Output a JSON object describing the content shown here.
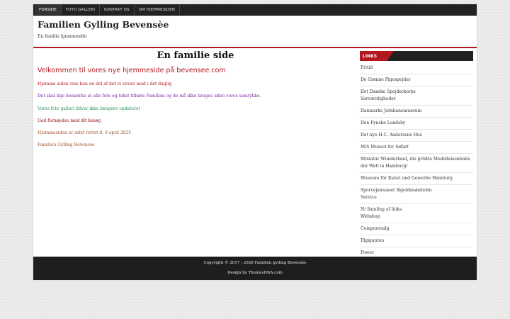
{
  "nav": {
    "items": [
      {
        "label": "Forside"
      },
      {
        "label": "Foto galleri"
      },
      {
        "label": "Kontakt os"
      },
      {
        "label": "Om hjemmesiden"
      }
    ]
  },
  "header": {
    "title": "Familien Gylling Bevensèe",
    "description": "En familie hjemmeside"
  },
  "main": {
    "page_title": "En familie side",
    "welcome": "Velkommen til vores nye hjemmeside på bevensee.com",
    "paragraphs": [
      {
        "text": "Hjemme siden vise kun en del af det vi sysler med i det daglig",
        "color": "#b3181f"
      },
      {
        "text": "Det skal lige bemærke at alle foto og tekst tilhøre Familien og de må ikke bruges uden vores samtykke.",
        "color": "#7b1fa2"
      },
      {
        "text": "Vores foto galleri bliver ikke længere opdateret",
        "color": "#2e8b57"
      },
      {
        "text": "God fornøjelse med dit besøg",
        "color": "#8b0000"
      },
      {
        "text": "Hjemmesiden er sidst rettet d. 9 april 2025",
        "color": "#a0522d"
      },
      {
        "text": "Familien Gylling Bevensèe",
        "color": "#a0522d"
      }
    ]
  },
  "sidebar": {
    "heading": "LINKS",
    "links": [
      {
        "label": "Fritid"
      },
      {
        "label": "De Grønne Pigespejder"
      },
      {
        "label": "Det Danske Spejderkorps\nServærdigheder"
      },
      {
        "label": "Danmarks Jernbanemuseum"
      },
      {
        "label": "Den Fynske Landsby"
      },
      {
        "label": "Det nye H.C. Andersens Hus"
      },
      {
        "label": "M/S Museet for Søfart"
      },
      {
        "label": "Miniatur Wunderland, die größte Modelleisenbahn der Welt in Hamburg!"
      },
      {
        "label": "Museum für Kunst und Gewerbe Hamburg"
      },
      {
        "label": "Sporvejsmuseet Skjoldenæsholm\nService"
      },
      {
        "label": "Ni Samling af links\nWebshop"
      },
      {
        "label": "Compuersalg"
      },
      {
        "label": "Elgiganten"
      },
      {
        "label": "Power"
      }
    ]
  },
  "footer": {
    "copyright": "Copyright © 2017 - 2026 Familien gylling Bevensèe",
    "credit": "Design by ThemesDNA.com"
  }
}
